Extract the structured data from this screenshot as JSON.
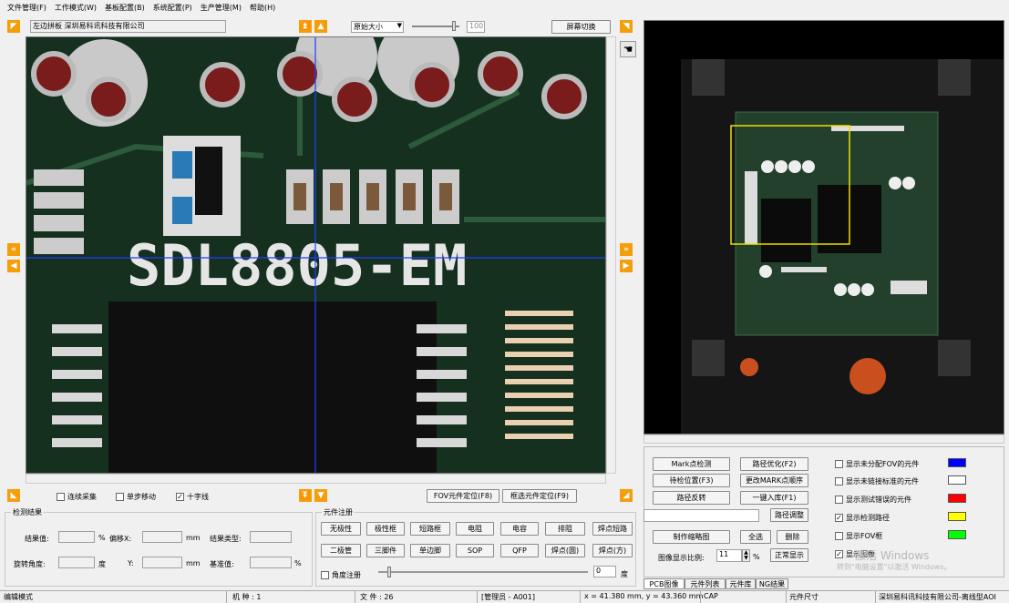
{
  "menu": [
    "文件管理(F)",
    "工作模式(W)",
    "基板配置(B)",
    "系统配置(P)",
    "生产管理(M)",
    "帮助(H)"
  ],
  "toolbar": {
    "board_info": "左边拼板   深圳易科讯科技有限公司",
    "zoom_select": "原始大小",
    "zoom_value": "100",
    "screen_switch": "屏幕切换"
  },
  "left_bottom": {
    "continuous_capture": "连续采集",
    "step_move": "单步移动",
    "crosshair": "十字线",
    "fov_locate": "FOV元件定位(F8)",
    "frame_locate": "框选元件定位(F9)"
  },
  "result": {
    "title": "检测结果",
    "result_value": "结果值:",
    "pct": "%",
    "offset_x": "偏移X:",
    "mm": "mm",
    "result_type": "结果类型:",
    "rotation": "旋转角度:",
    "deg": "度",
    "y": "Y:",
    "mm2": "mm",
    "base_value": "基准值:",
    "pct2": "%"
  },
  "register": {
    "title": "元件注册",
    "buttons_row1": [
      "无极性",
      "极性框",
      "短路框",
      "电阻",
      "电容",
      "排阻",
      "焊点短路"
    ],
    "buttons_row2": [
      "二极管",
      "三脚件",
      "单边脚",
      "SOP",
      "QFP",
      "焊点(圆)",
      "焊点(方)"
    ],
    "angle_register": "角度注册",
    "angle_value": "0",
    "angle_unit": "度"
  },
  "right_panel": {
    "mark_check": "Mark点检测",
    "path_optimize": "路径优化(F2)",
    "check_position": "待检位置(F3)",
    "change_mark_order": "更改MARK点顺序",
    "path_reverse": "路径反转",
    "one_key_import": "一键入库(F1)",
    "path_adjust": "路径调整",
    "make_thumbnail": "制作缩略图",
    "select_all": "全选",
    "delete": "删除",
    "display_ratio_label": "图像显示比例:",
    "display_ratio_value": "11",
    "display_ratio_unit": "%",
    "normal_display": "正常显示"
  },
  "options": [
    {
      "label": "显示未分配FOV的元件",
      "checked": false,
      "color": "#0000ff"
    },
    {
      "label": "显示未链接标准的元件",
      "checked": false,
      "color": "#ffffff"
    },
    {
      "label": "显示测试错误的元件",
      "checked": false,
      "color": "#ff0000"
    },
    {
      "label": "显示检测路径",
      "checked": true,
      "color": "#ffff00"
    },
    {
      "label": "显示FOV框",
      "checked": false,
      "color": "#00ff00"
    },
    {
      "label": "显示图像",
      "checked": true,
      "color": ""
    }
  ],
  "tabs": [
    "PCB图像",
    "元件列表",
    "元件库",
    "NG结果"
  ],
  "watermark": {
    "line1": "激活 Windows",
    "line2": "转到\"电脑设置\"以激活 Windows。"
  },
  "statusbar": {
    "mode": "编辑模式",
    "machine": "机 种 : 1",
    "file": "文 件 : 26",
    "operator": "[管理员 - A001]",
    "coords": "x = 41.380 mm, y = 43.360 mm",
    "cap": "CAP",
    "component_size": "元件尺寸",
    "company": "深圳易科讯科技有限公司-离线型AOI"
  },
  "pcb_silkscreen": "SDL8805-EM",
  "thumb_silkscreen": "SDL8805-EM"
}
